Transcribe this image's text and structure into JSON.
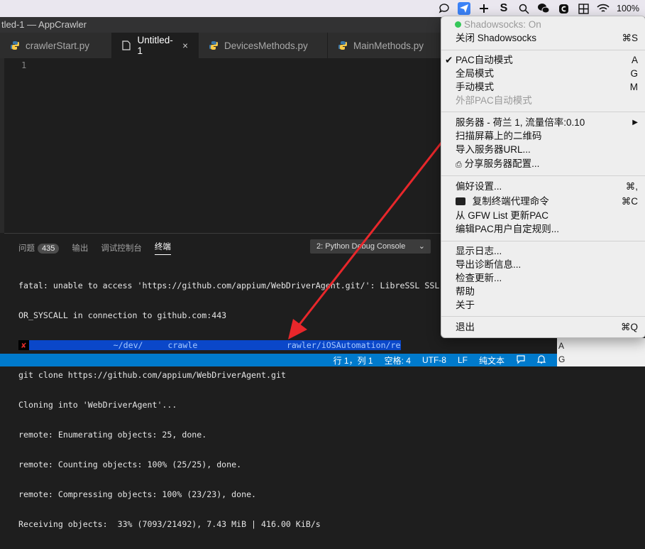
{
  "menubar": {
    "battery": "100%",
    "icons": [
      "chat-icon",
      "shadowsocks-paper-plane-icon",
      "fan-icon",
      "s-icon",
      "search-icon",
      "wechat-icon",
      "c-icon",
      "grid-icon",
      "wifi-icon",
      "battery-icon"
    ]
  },
  "window": {
    "title": "tled-1 — AppCrawler"
  },
  "tabs": [
    {
      "label": "crawlerStart.py"
    },
    {
      "label": "Untitled-1",
      "close": "×"
    },
    {
      "label": "DevicesMethods.py"
    },
    {
      "label": "MainMethods.py"
    }
  ],
  "editor": {
    "line1": "1"
  },
  "panel": {
    "tab_problems": "问题",
    "problems_count": "435",
    "tab_output": "输出",
    "tab_debug": "调试控制台",
    "tab_terminal": "终端",
    "console_select": "2: Python Debug Console"
  },
  "terminal": {
    "lines": [
      "fatal: unable to access 'https://github.com/appium/WebDriverAgent.git/': LibreSSL SSL",
      "OR_SYSCALL in connection to github.com:443",
      "",
      "git clone https://github.com/appium/WebDriverAgent.git",
      "Cloning into 'WebDriverAgent'...",
      "remote: Enumerating objects: 25, done.",
      "remote: Counting objects: 100% (25/25), done.",
      "remote: Compressing objects: 100% (23/23), done.",
      "Receiving objects:  33% (7093/21492), 7.43 MiB | 416.00 KiB/s"
    ],
    "prompt_x": "✘",
    "prompt_path": "~/dev/     crawle                  rawler/iOSAutomation/re"
  },
  "statusbar": {
    "position": "行 1，列 1",
    "spaces": "空格: 4",
    "encoding": "UTF-8",
    "eol": "LF",
    "language": "纯文本"
  },
  "right_edge": {
    "letters": [
      "A",
      "G"
    ]
  },
  "shadowsocks_menu": {
    "status": "Shadowsocks: On",
    "toggle": {
      "label": "关闭 Shadowsocks",
      "shortcut": "⌘S"
    },
    "modes": [
      {
        "label": "PAC自动模式",
        "shortcut": "A",
        "checked": true
      },
      {
        "label": "全局模式",
        "shortcut": "G"
      },
      {
        "label": "手动模式",
        "shortcut": "M"
      },
      {
        "label": "外部PAC自动模式",
        "shortcut": "",
        "disabled": true
      }
    ],
    "server": {
      "label": "服务器 - 荷兰 1, 流量倍率:0.10",
      "shortcut": "▶"
    },
    "scan_qr": "扫描屏幕上的二维码",
    "import_url": "导入服务器URL...",
    "share_config": "分享服务器配置...",
    "preferences": {
      "label": "偏好设置...",
      "shortcut": "⌘,"
    },
    "copy_terminal": {
      "label": "复制终端代理命令",
      "shortcut": "⌘C"
    },
    "update_pac": "从 GFW List 更新PAC",
    "edit_pac": "编辑PAC用户自定规则...",
    "show_log": "显示日志...",
    "export_diag": "导出诊断信息...",
    "check_update": "检查更新...",
    "help": "帮助",
    "about": "关于",
    "quit": {
      "label": "退出",
      "shortcut": "⌘Q"
    }
  },
  "colors": {
    "statusbar": "#007acc",
    "arrow": "#e8272b",
    "status_dot": "#35c759"
  }
}
